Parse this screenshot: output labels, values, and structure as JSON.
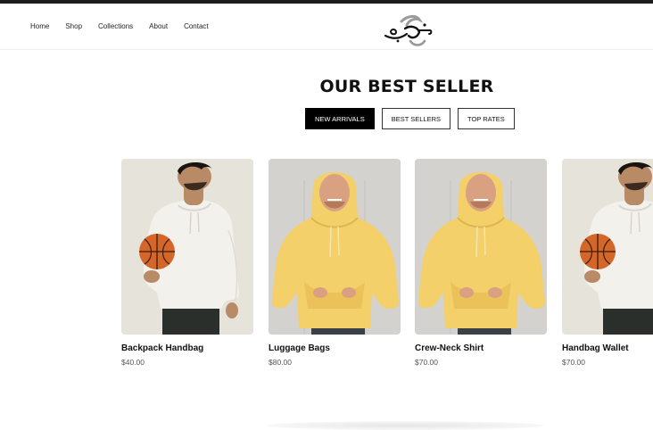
{
  "nav": {
    "items": [
      "Home",
      "Shop",
      "Collections",
      "About",
      "Contact"
    ]
  },
  "section": {
    "title": "OUR BEST SELLER"
  },
  "filters": [
    {
      "label": "NEW ARRIVALS",
      "active": true
    },
    {
      "label": "BEST SELLERS",
      "active": false
    },
    {
      "label": "TOP RATES",
      "active": false
    }
  ],
  "products": [
    {
      "name": "Backpack Handbag",
      "price": "$40.00",
      "image": "model-white-hoodie-basketball"
    },
    {
      "name": "Luggage Bags",
      "price": "$80.00",
      "image": "model-yellow-hoodie"
    },
    {
      "name": "Crew-Neck Shirt",
      "price": "$70.00",
      "image": "model-yellow-hoodie"
    },
    {
      "name": "Handbag Wallet",
      "price": "$70.00",
      "image": "model-white-hoodie-basketball"
    }
  ],
  "colors": {
    "accent": "#000000",
    "beige_bg": "#e6e4da",
    "concrete_bg": "#d8d6d2",
    "yellow_hoodie": "#f3d06a",
    "white_hoodie": "#f2f1ec"
  }
}
